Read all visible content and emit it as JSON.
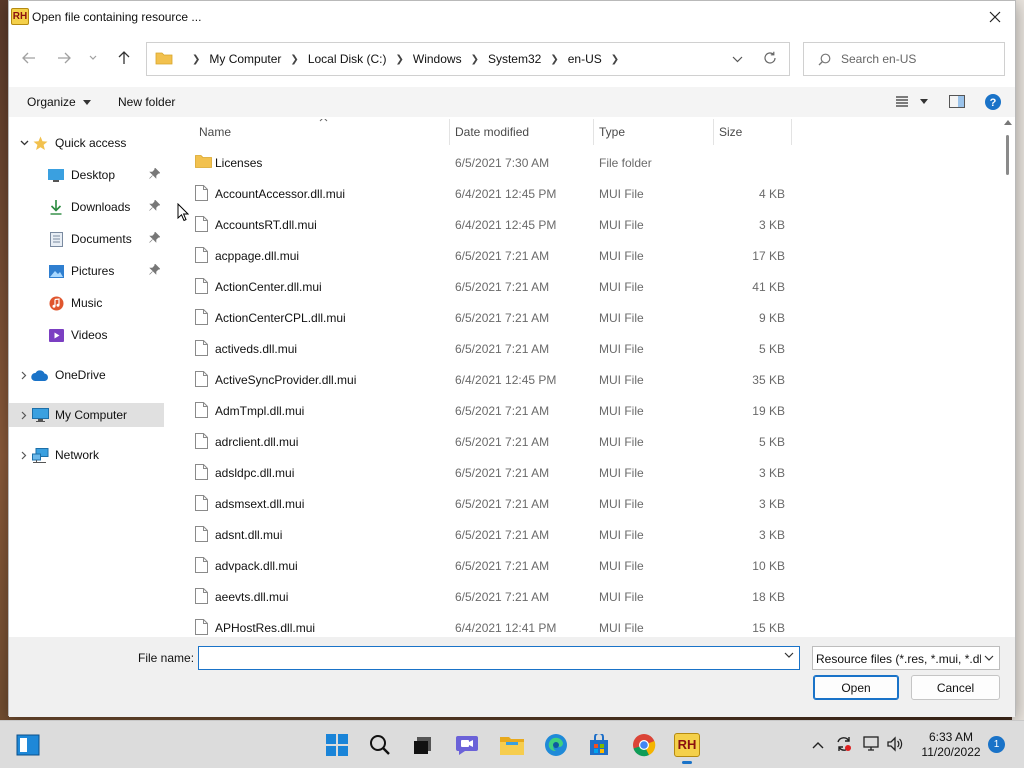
{
  "window": {
    "title": "Open file containing resource ...",
    "app_logo_text": "RH"
  },
  "address": {
    "crumbs": [
      "My Computer",
      "Local Disk (C:)",
      "Windows",
      "System32",
      "en-US"
    ],
    "search_placeholder": "Search en-US"
  },
  "toolbar": {
    "organize_label": "Organize",
    "new_folder_label": "New folder"
  },
  "sidebar": {
    "quick_access": "Quick access",
    "desktop": "Desktop",
    "downloads": "Downloads",
    "documents": "Documents",
    "pictures": "Pictures",
    "music": "Music",
    "videos": "Videos",
    "onedrive": "OneDrive",
    "my_computer": "My Computer",
    "network": "Network"
  },
  "columns": {
    "name": "Name",
    "date": "Date modified",
    "type": "Type",
    "size": "Size"
  },
  "files": [
    {
      "name": "Licenses",
      "date": "6/5/2021 7:30 AM",
      "type": "File folder",
      "size": "",
      "folder": true
    },
    {
      "name": "AccountAccessor.dll.mui",
      "date": "6/4/2021 12:45 PM",
      "type": "MUI File",
      "size": "4 KB"
    },
    {
      "name": "AccountsRT.dll.mui",
      "date": "6/4/2021 12:45 PM",
      "type": "MUI File",
      "size": "3 KB"
    },
    {
      "name": "acppage.dll.mui",
      "date": "6/5/2021 7:21 AM",
      "type": "MUI File",
      "size": "17 KB"
    },
    {
      "name": "ActionCenter.dll.mui",
      "date": "6/5/2021 7:21 AM",
      "type": "MUI File",
      "size": "41 KB"
    },
    {
      "name": "ActionCenterCPL.dll.mui",
      "date": "6/5/2021 7:21 AM",
      "type": "MUI File",
      "size": "9 KB"
    },
    {
      "name": "activeds.dll.mui",
      "date": "6/5/2021 7:21 AM",
      "type": "MUI File",
      "size": "5 KB"
    },
    {
      "name": "ActiveSyncProvider.dll.mui",
      "date": "6/4/2021 12:45 PM",
      "type": "MUI File",
      "size": "35 KB"
    },
    {
      "name": "AdmTmpl.dll.mui",
      "date": "6/5/2021 7:21 AM",
      "type": "MUI File",
      "size": "19 KB"
    },
    {
      "name": "adrclient.dll.mui",
      "date": "6/5/2021 7:21 AM",
      "type": "MUI File",
      "size": "5 KB"
    },
    {
      "name": "adsldpc.dll.mui",
      "date": "6/5/2021 7:21 AM",
      "type": "MUI File",
      "size": "3 KB"
    },
    {
      "name": "adsmsext.dll.mui",
      "date": "6/5/2021 7:21 AM",
      "type": "MUI File",
      "size": "3 KB"
    },
    {
      "name": "adsnt.dll.mui",
      "date": "6/5/2021 7:21 AM",
      "type": "MUI File",
      "size": "3 KB"
    },
    {
      "name": "advpack.dll.mui",
      "date": "6/5/2021 7:21 AM",
      "type": "MUI File",
      "size": "10 KB"
    },
    {
      "name": "aeevts.dll.mui",
      "date": "6/5/2021 7:21 AM",
      "type": "MUI File",
      "size": "18 KB"
    },
    {
      "name": "APHostRes.dll.mui",
      "date": "6/4/2021 12:41 PM",
      "type": "MUI File",
      "size": "15 KB"
    }
  ],
  "bottom": {
    "filename_label": "File name:",
    "filename_value": "",
    "filter_label": "Resource files (*.res, *.mui, *.dll",
    "open_label": "Open",
    "cancel_label": "Cancel"
  },
  "taskbar": {
    "time": "6:33 AM",
    "date": "11/20/2022",
    "notification_count": "1"
  },
  "colors": {
    "accent": "#1a73c8",
    "folder": "#f2c14e"
  }
}
